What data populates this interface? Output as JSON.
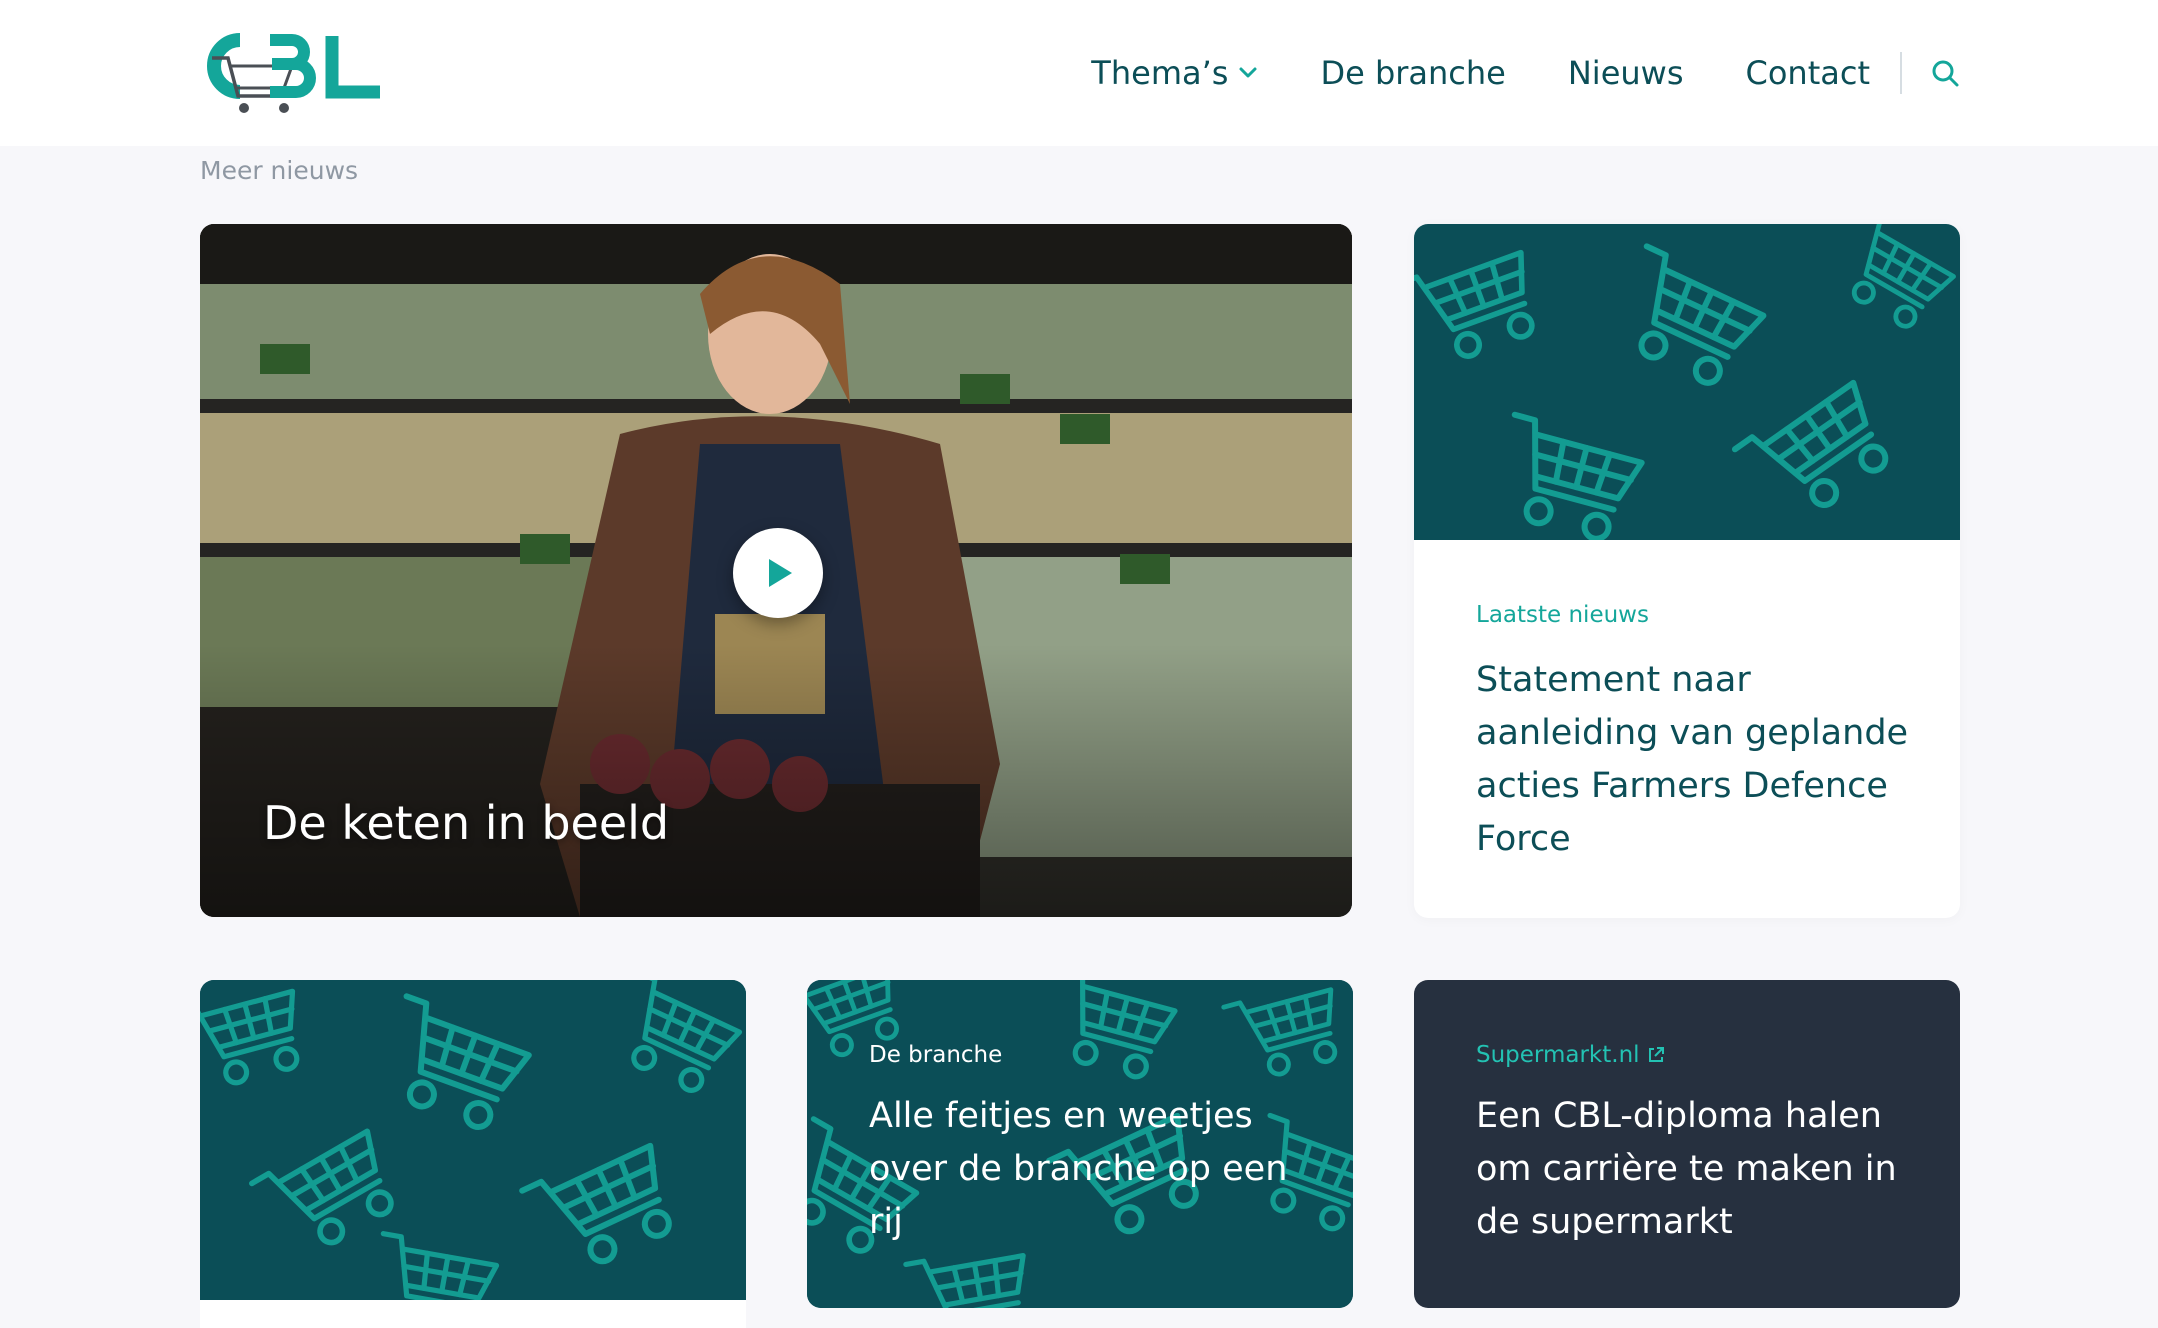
{
  "header": {
    "logo_text": "CBL",
    "nav": [
      {
        "label": "Thema’s",
        "has_dropdown": true
      },
      {
        "label": "De branche"
      },
      {
        "label": "Nieuws"
      },
      {
        "label": "Contact"
      }
    ],
    "search_icon": "search-icon"
  },
  "breadcrumb": "Meer nieuws",
  "hero": {
    "title": "De keten in beeld",
    "play_icon": "play-icon"
  },
  "news_card": {
    "kicker": "Laatste nieuws",
    "title": "Statement naar aanleiding van geplande acties Farmers Defence Force"
  },
  "card_two": {
    "kicker": "De branche",
    "title": "Alle feitjes en weetjes over de branche op een rij"
  },
  "card_three": {
    "kicker": "Supermarkt.nl",
    "kicker_icon": "external-link-icon",
    "title": "Een CBL-diploma halen om carrière te maken in de supermarkt"
  },
  "colors": {
    "brand_teal": "#14a69a",
    "dark_teal": "#0b4e57",
    "navy": "#26303f",
    "nav_text": "#0c4e57"
  }
}
